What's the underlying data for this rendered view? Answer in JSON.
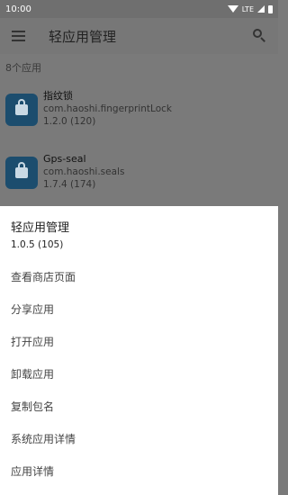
{
  "status_bar": {
    "time": "10:00",
    "network": "LTE"
  },
  "app_bar": {
    "title": "轻应用管理"
  },
  "list": {
    "count_label": "8个应用",
    "apps": [
      {
        "name": "指纹锁",
        "package": "com.haoshi.fingerprintLock",
        "version": "1.2.0 (120)"
      },
      {
        "name": "Gps-seal",
        "package": "com.haoshi.seals",
        "version": "1.7.4 (174)"
      }
    ]
  },
  "sheet": {
    "title": "轻应用管理",
    "version": "1.0.5 (105)",
    "items": [
      {
        "label": "查看商店页面"
      },
      {
        "label": "分享应用"
      },
      {
        "label": "打开应用"
      },
      {
        "label": "卸载应用"
      },
      {
        "label": "复制包名"
      },
      {
        "label": "系统应用详情"
      },
      {
        "label": "应用详情"
      }
    ]
  },
  "colors": {
    "sheet_background": "#ffffff",
    "scrim": "#7a7a7a",
    "app_icon": "#1c4d6e"
  },
  "icons": [
    "menu-icon",
    "search-icon",
    "wifi-icon",
    "signal-icon",
    "battery-icon",
    "fingerprint-lock-icon",
    "gps-lock-icon"
  ]
}
